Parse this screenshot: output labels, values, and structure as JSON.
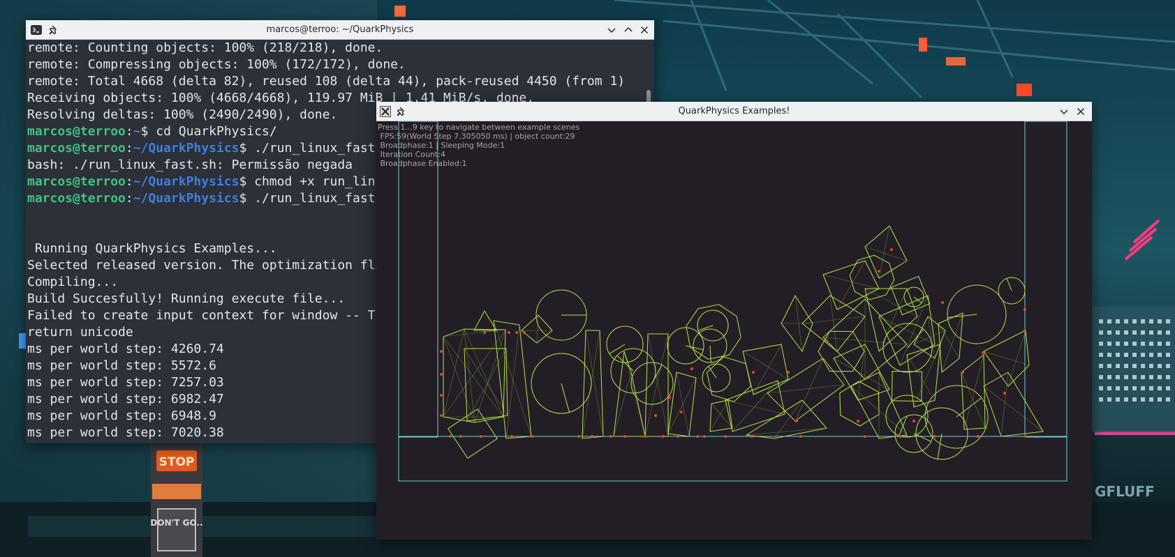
{
  "terminal": {
    "title": "marcos@terroo: ~/QuarkPhysics",
    "lines": [
      {
        "text": "remote: Counting objects: 100% (218/218), done."
      },
      {
        "text": "remote: Compressing objects: 100% (172/172), done."
      },
      {
        "text": "remote: Total 4668 (delta 82), reused 108 (delta 44), pack-reused 4450 (from 1)"
      },
      {
        "text": "Receiving objects: 100% (4668/4668), 119.97 MiB | 1.41 MiB/s, done."
      },
      {
        "text": "Resolving deltas: 100% (2490/2490), done."
      },
      {
        "prompt": {
          "user": "marcos@terroo",
          "sep": ":",
          "path": "~",
          "dollar": "$"
        },
        "command": " cd QuarkPhysics/"
      },
      {
        "prompt": {
          "user": "marcos@terroo",
          "sep": ":",
          "path": "~/QuarkPhysics",
          "dollar": "$"
        },
        "command": " ./run_linux_fast.sh"
      },
      {
        "text": "bash: ./run_linux_fast.sh: Permissão negada"
      },
      {
        "prompt": {
          "user": "marcos@terroo",
          "sep": ":",
          "path": "~/QuarkPhysics",
          "dollar": "$"
        },
        "command": " chmod +x run_linux_fast.sh"
      },
      {
        "prompt": {
          "user": "marcos@terroo",
          "sep": ":",
          "path": "~/QuarkPhysics",
          "dollar": "$"
        },
        "command": " ./run_linux_fast.sh"
      },
      {
        "text": ""
      },
      {
        "text": ""
      },
      {
        "text": " Running QuarkPhysics Examples..."
      },
      {
        "text": "Selected released version. The optimization flags"
      },
      {
        "text": "Compiling..."
      },
      {
        "text": "Build Succesfully! Running execute file..."
      },
      {
        "text": "Failed to create input context for window -- T"
      },
      {
        "text": "return unicode"
      },
      {
        "text": "ms per world step: 4260.74"
      },
      {
        "text": "ms per world step: 5572.6"
      },
      {
        "text": "ms per world step: 7257.03"
      },
      {
        "text": "ms per world step: 6982.47"
      },
      {
        "text": "ms per world step: 6948.9"
      },
      {
        "text": "ms per world step: 7020.38"
      }
    ]
  },
  "quark": {
    "title": "QuarkPhysics Examples!",
    "hud": [
      "Press 1...9 key to navigate between example scenes",
      " FPS:59(World Step 7.305050 ms) | object count:29",
      " Broadphase:1 | Sleeping Mode:1",
      " Iteration Count:4",
      " Broadphase Enabled:1"
    ]
  },
  "wallpaper": {
    "signs": {
      "stop": "STOP",
      "dont_go": "DON'T GO..",
      "brand": "GFLUFF"
    }
  },
  "colors": {
    "body_stroke": "#b5e34a",
    "mesh_stroke": "#8fae3c",
    "point": "#e5452c",
    "boundary": "#6ad3d8",
    "viewport_bg": "#231e25"
  }
}
